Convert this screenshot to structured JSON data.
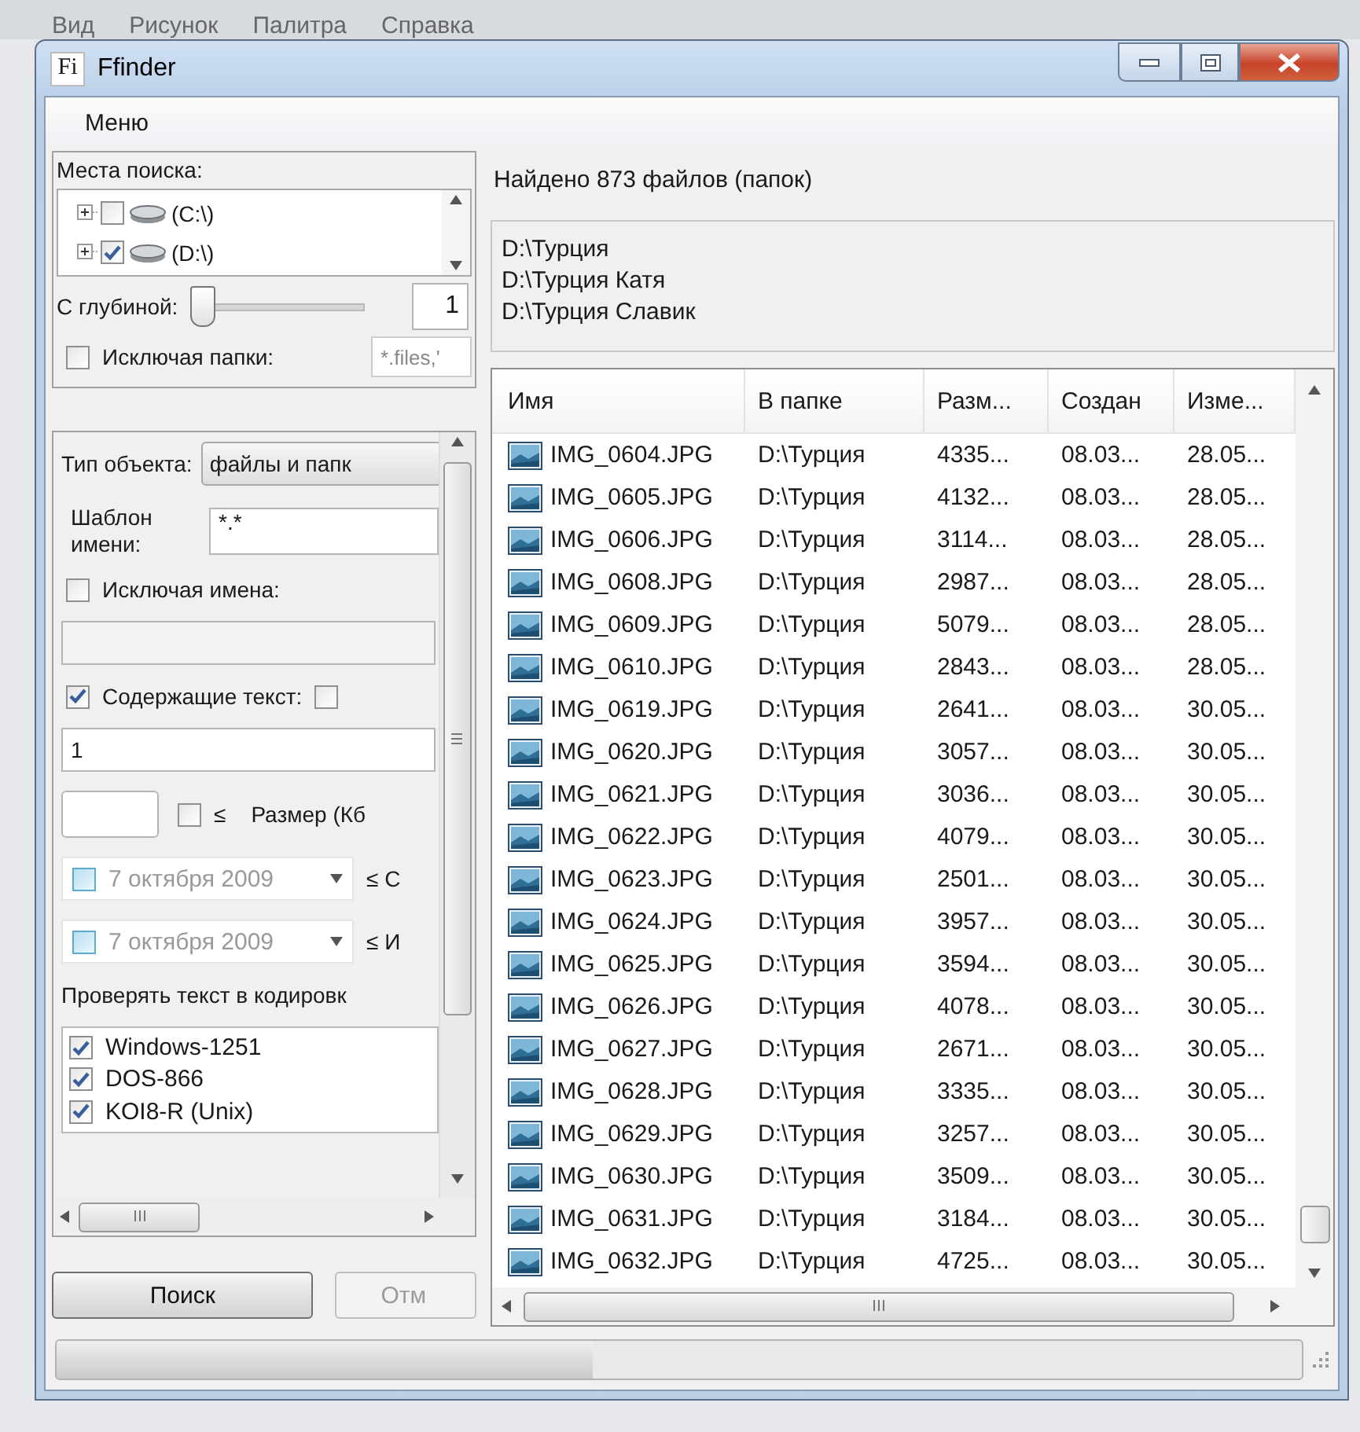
{
  "background_menu": [
    "Вид",
    "Рисунок",
    "Палитра",
    "Справка"
  ],
  "window": {
    "title": "Ffinder",
    "icon_text": "Fi"
  },
  "menu": [
    "Меню"
  ],
  "places": {
    "label": "Места поиска:",
    "tree": [
      {
        "label": "(C:\\)",
        "checked": false
      },
      {
        "label": "(D:\\)",
        "checked": true
      }
    ]
  },
  "depth": {
    "label": "С глубиной:",
    "level": 0,
    "value": "1"
  },
  "exclude_folders": {
    "label": "Исключая папки:",
    "checked": false,
    "placeholder": "*.files,'"
  },
  "object_type": {
    "label": "Тип объекта:",
    "value": "файлы и папк"
  },
  "name_pattern": {
    "label": "Шаблон имени:",
    "value": "*.*"
  },
  "exclude_names": {
    "label": "Исключая имена:",
    "checked": false
  },
  "contains_text": {
    "label": "Содержащие текст:",
    "checked": true,
    "option_checked": false,
    "value": "1"
  },
  "size": {
    "checked": false,
    "sign": "≤",
    "label": "Размер (Кб"
  },
  "dates": [
    {
      "checked": false,
      "date": "7 октября 2009",
      "label": "≤ С"
    },
    {
      "checked": false,
      "date": "7 октября 2009",
      "label": "≤ И"
    }
  ],
  "encodings": {
    "label": "Проверять текст в кодировк",
    "items": [
      {
        "label": "Windows-1251",
        "checked": true
      },
      {
        "label": "DOS-866",
        "checked": true
      },
      {
        "label": "KOI8-R (Unix)",
        "checked": true
      }
    ]
  },
  "buttons": [
    {
      "label": "Поиск",
      "disabled": false
    },
    {
      "label": "Отм",
      "disabled": true
    }
  ],
  "results": {
    "summary": "Найдено 873 файлов (папок)",
    "folders": [
      "D:\\Турция",
      "D:\\Турция Катя",
      "D:\\Турция Славик"
    ],
    "columns": [
      "Имя",
      "В папке",
      "Разм...",
      "Создан",
      "Изме..."
    ],
    "rows": [
      [
        "IMG_0604.JPG",
        "D:\\Турция",
        "4335...",
        "08.03...",
        "28.05..."
      ],
      [
        "IMG_0605.JPG",
        "D:\\Турция",
        "4132...",
        "08.03...",
        "28.05..."
      ],
      [
        "IMG_0606.JPG",
        "D:\\Турция",
        "3114...",
        "08.03...",
        "28.05..."
      ],
      [
        "IMG_0608.JPG",
        "D:\\Турция",
        "2987...",
        "08.03...",
        "28.05..."
      ],
      [
        "IMG_0609.JPG",
        "D:\\Турция",
        "5079...",
        "08.03...",
        "28.05..."
      ],
      [
        "IMG_0610.JPG",
        "D:\\Турция",
        "2843...",
        "08.03...",
        "28.05..."
      ],
      [
        "IMG_0619.JPG",
        "D:\\Турция",
        "2641...",
        "08.03...",
        "30.05..."
      ],
      [
        "IMG_0620.JPG",
        "D:\\Турция",
        "3057...",
        "08.03...",
        "30.05..."
      ],
      [
        "IMG_0621.JPG",
        "D:\\Турция",
        "3036...",
        "08.03...",
        "30.05..."
      ],
      [
        "IMG_0622.JPG",
        "D:\\Турция",
        "4079...",
        "08.03...",
        "30.05..."
      ],
      [
        "IMG_0623.JPG",
        "D:\\Турция",
        "2501...",
        "08.03...",
        "30.05..."
      ],
      [
        "IMG_0624.JPG",
        "D:\\Турция",
        "3957...",
        "08.03...",
        "30.05..."
      ],
      [
        "IMG_0625.JPG",
        "D:\\Турция",
        "3594...",
        "08.03...",
        "30.05..."
      ],
      [
        "IMG_0626.JPG",
        "D:\\Турция",
        "4078...",
        "08.03...",
        "30.05..."
      ],
      [
        "IMG_0627.JPG",
        "D:\\Турция",
        "2671...",
        "08.03...",
        "30.05..."
      ],
      [
        "IMG_0628.JPG",
        "D:\\Турция",
        "3335...",
        "08.03...",
        "30.05..."
      ],
      [
        "IMG_0629.JPG",
        "D:\\Турция",
        "3257...",
        "08.03...",
        "30.05..."
      ],
      [
        "IMG_0630.JPG",
        "D:\\Турция",
        "3509...",
        "08.03...",
        "30.05..."
      ],
      [
        "IMG_0631.JPG",
        "D:\\Турция",
        "3184...",
        "08.03...",
        "30.05..."
      ],
      [
        "IMG_0632.JPG",
        "D:\\Турция",
        "4725...",
        "08.03...",
        "30.05..."
      ]
    ]
  },
  "status_bar": {
    "progress": {
      "level": 0.43
    }
  }
}
